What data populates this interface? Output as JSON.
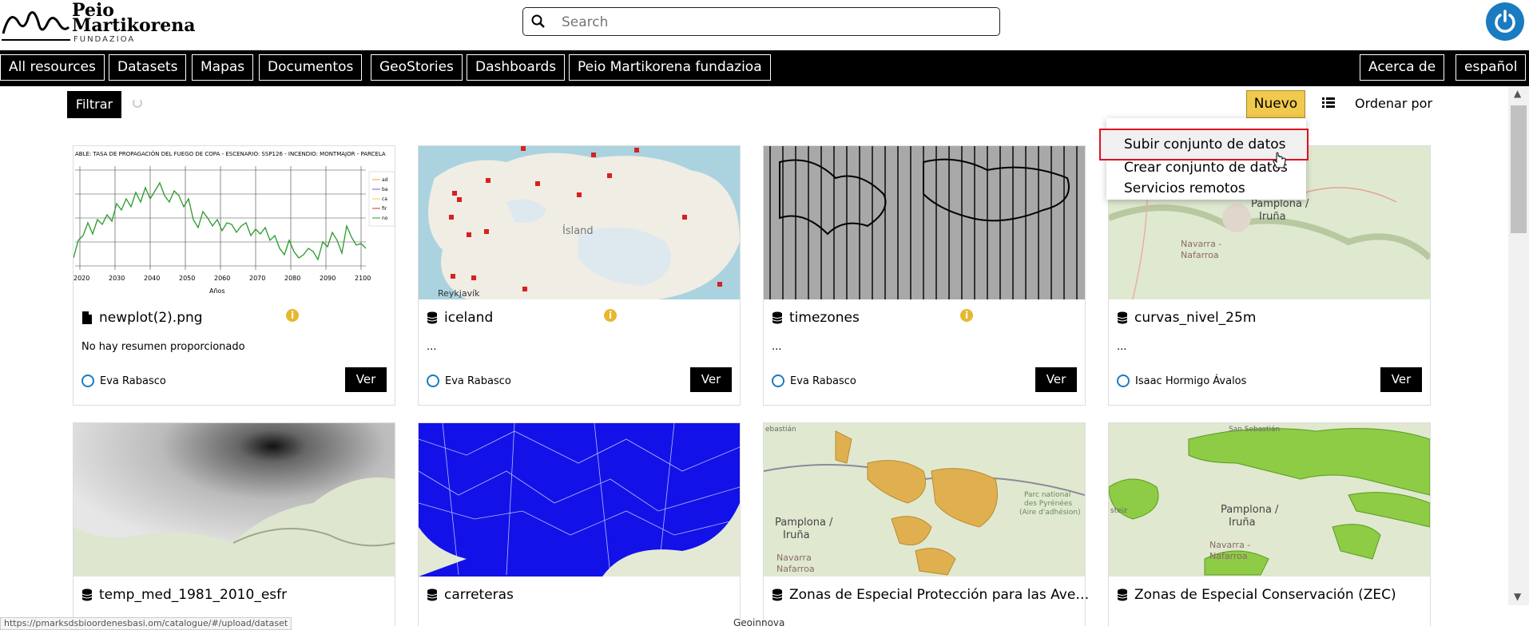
{
  "header": {
    "logo_line1": "Peio",
    "logo_line2": "Martikorena",
    "logo_line3": "FUNDAZIOA",
    "search_placeholder": "Search"
  },
  "nav": {
    "items": [
      "All resources",
      "Datasets",
      "Mapas",
      "Documentos",
      "GeoStories",
      "Dashboards",
      "Peio Martikorena fundazioa"
    ],
    "right_items": [
      "Acerca de",
      "español"
    ]
  },
  "toolbar": {
    "filter_label": "Filtrar",
    "nuevo_label": "Nuevo",
    "sort_label": "Ordenar por"
  },
  "dropdown": {
    "items": [
      "Subir conjunto de datos",
      "Crear conjunto de datos",
      "Servicios remotos"
    ]
  },
  "cards": [
    {
      "title": "newplot(2).png",
      "summary": "No hay resumen proporcionado",
      "owner": "Eva Rabasco",
      "action": "Ver",
      "chart_text": "ABLE: TASA DE PROPAGACIÓN DEL FUEGO DE COPA - ESCENARIO: SSP126 - INCENDIO: MONTMAJOR - PARCELA",
      "years": [
        "2020",
        "2030",
        "2040",
        "2050",
        "2060",
        "2070",
        "2080",
        "2090",
        "2100"
      ],
      "axis_label": "Años",
      "legend": [
        "ad",
        "ba",
        "ca",
        "fir",
        "no"
      ]
    },
    {
      "title": "iceland",
      "summary": "...",
      "owner": "Eva Rabasco",
      "action": "Ver",
      "map_labels": [
        "Ísland",
        "Reykjavík"
      ]
    },
    {
      "title": "timezones",
      "summary": "...",
      "owner": "Eva Rabasco",
      "action": "Ver"
    },
    {
      "title": "curvas_nivel_25m",
      "summary": "...",
      "owner": "Isaac Hormigo Ávalos",
      "action": "Ver",
      "map_labels": [
        "Pamplona /",
        "Iruña",
        "Navarra -",
        "Nafarroa"
      ]
    },
    {
      "title": "temp_med_1981_2010_esfr"
    },
    {
      "title": "carreteras"
    },
    {
      "title": "Zonas de Especial Protección para las Ave…",
      "map_labels": [
        "Pamplona /",
        "Iruña",
        "Navarra",
        "Nafarroa",
        "Parc national",
        "des Pyrénées",
        "(Aire d'adhésion)"
      ]
    },
    {
      "title": "Zonas de Especial Conservación (ZEC)",
      "map_labels": [
        "Pamplona /",
        "Iruña",
        "Navarra -",
        "Nafarroa",
        "San Sebastián"
      ]
    }
  ],
  "statusbar": {
    "url": "https://pmarksdsbioordenesbasi.om/catalogue/#/upload/dataset",
    "footer": "Geoinnova"
  },
  "colors": {
    "accent": "#f0c94d",
    "brand_blue": "#1a7bc1",
    "highlight_border": "#dd1122"
  }
}
